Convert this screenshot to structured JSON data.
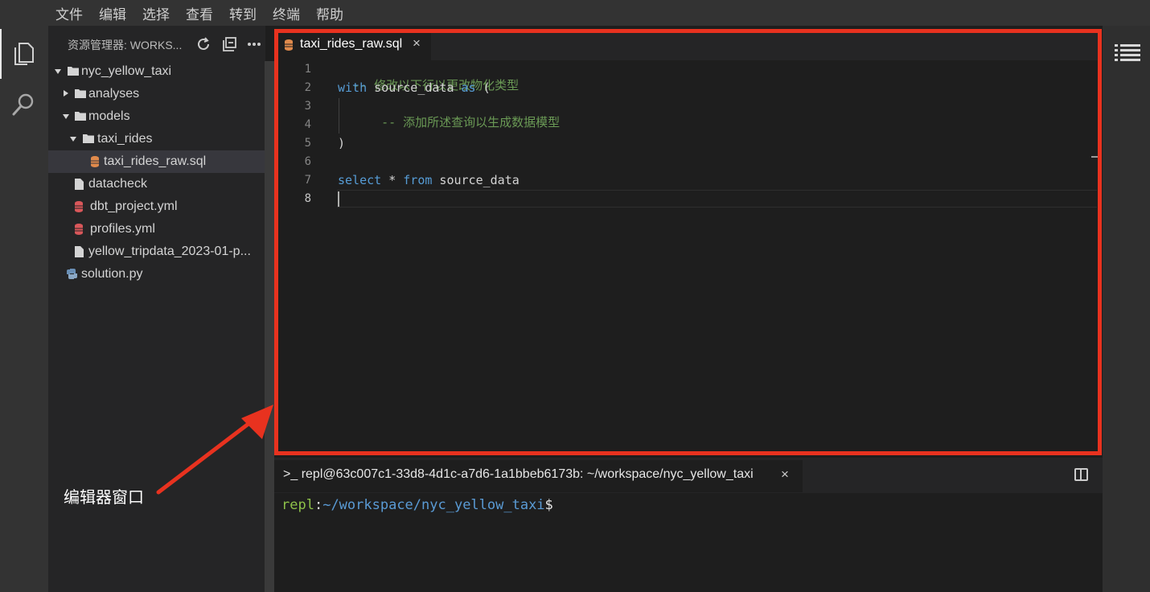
{
  "menu": {
    "items": [
      "文件",
      "编辑",
      "选择",
      "查看",
      "转到",
      "终端",
      "帮助"
    ]
  },
  "activity_bar": {
    "icons": [
      "files-icon",
      "search-icon"
    ]
  },
  "sidebar": {
    "title": "资源管理器: WORKS...",
    "tools": [
      "refresh-icon",
      "collapse-all-icon",
      "more-icon"
    ],
    "tree": [
      {
        "label": "nyc_yellow_taxi",
        "kind": "folder",
        "expanded": true
      },
      {
        "label": "analyses",
        "kind": "folder",
        "expanded": false
      },
      {
        "label": "models",
        "kind": "folder",
        "expanded": true
      },
      {
        "label": "taxi_rides",
        "kind": "folder",
        "expanded": true
      },
      {
        "label": "taxi_rides_raw.sql",
        "kind": "sql",
        "selected": true
      },
      {
        "label": "datacheck",
        "kind": "file"
      },
      {
        "label": "dbt_project.yml",
        "kind": "yml"
      },
      {
        "label": "profiles.yml",
        "kind": "yml"
      },
      {
        "label": "yellow_tripdata_2023-01-p...",
        "kind": "file"
      },
      {
        "label": "solution.py",
        "kind": "python"
      }
    ]
  },
  "editor": {
    "tab_label": "taxi_rides_raw.sql",
    "tab_close": "×",
    "line_numbers": [
      "1",
      "2",
      "3",
      "4",
      "5",
      "6",
      "7",
      "8"
    ],
    "active_line": "8",
    "code": {
      "l1_comment": "-- 修改以下行以更改物化类型",
      "l2_kw_with": "with",
      "l2_name": " source_data ",
      "l2_kw_as": "as",
      "l2_paren": " (",
      "l3_comment": "-- 添加所述查询以生成数据模型",
      "l5_paren": ")",
      "l7_kw_select": "select",
      "l7_star": " * ",
      "l7_kw_from": "from",
      "l7_name": " source_data"
    }
  },
  "terminal": {
    "tab_label": "repl@63c007c1-33d8-4d1c-a7d6-1a1bbeb6173b: ~/workspace/nyc_yellow_taxi",
    "tab_prefix": ">_",
    "tab_close": "×",
    "prompt_user": "repl",
    "prompt_colon": ":",
    "prompt_path": "~/workspace/nyc_yellow_taxi",
    "prompt_symbol": "$"
  },
  "annotation": {
    "label": "编辑器窗口"
  },
  "colors": {
    "highlight": "#e8321f",
    "keyword": "#569cd6",
    "comment": "#6a9955",
    "prompt_user": "#8dc149",
    "prompt_path": "#5a9bd5"
  }
}
